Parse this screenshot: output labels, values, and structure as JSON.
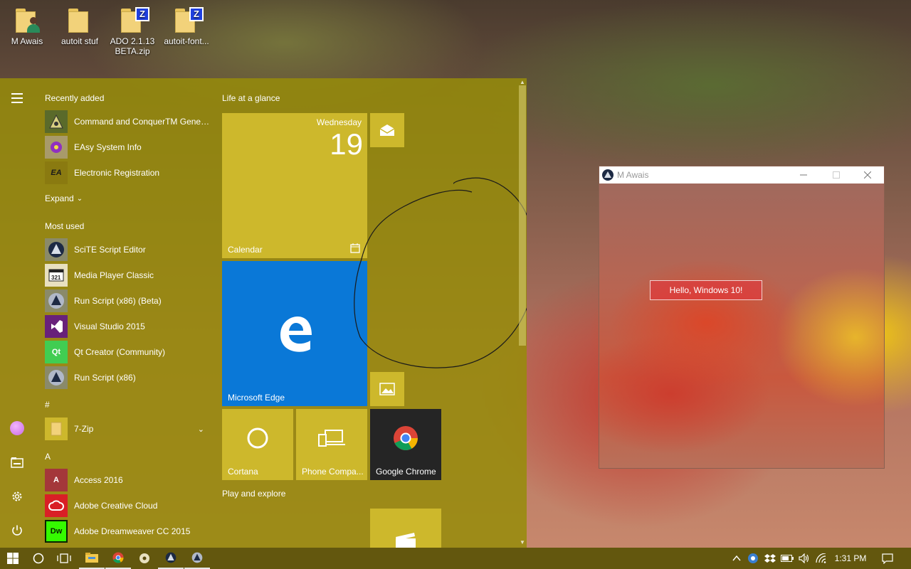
{
  "desktop": {
    "icons": [
      {
        "label": "M Awais"
      },
      {
        "label": "autoit stuf"
      },
      {
        "label": "ADO 2.1.13 BETA.zip"
      },
      {
        "label": "autoit-font..."
      }
    ],
    "zip_badge": "Z"
  },
  "start_menu": {
    "recently_added_header": "Recently added",
    "recently_added": [
      {
        "label": "Command and ConquerTM Gener..."
      },
      {
        "label": "EAsy System Info"
      },
      {
        "label": "Electronic Registration",
        "badge": "EA"
      }
    ],
    "expand_label": "Expand",
    "most_used_header": "Most used",
    "most_used": [
      {
        "label": "SciTE Script Editor"
      },
      {
        "label": "Media Player Classic"
      },
      {
        "label": "Run Script (x86) (Beta)"
      },
      {
        "label": "Visual Studio 2015"
      },
      {
        "label": "Qt Creator (Community)",
        "badge": "Qt"
      },
      {
        "label": "Run Script (x86)"
      }
    ],
    "hash_header": "#",
    "hash_items": [
      {
        "label": "7-Zip"
      }
    ],
    "a_header": "A",
    "a_items": [
      {
        "label": "Access 2016",
        "badge": "A"
      },
      {
        "label": "Adobe Creative Cloud"
      },
      {
        "label": "Adobe Dreamweaver CC 2015",
        "badge": "Dw"
      }
    ]
  },
  "tiles": {
    "group1_title": "Life at a glance",
    "calendar": {
      "day_name": "Wednesday",
      "day_number": "19",
      "label": "Calendar"
    },
    "edge": {
      "label": "Microsoft Edge"
    },
    "cortana": {
      "label": "Cortana"
    },
    "phone": {
      "label": "Phone Compa..."
    },
    "chrome": {
      "label": "Google Chrome"
    },
    "group2_title": "Play and explore",
    "colors": {
      "tile_yellow": "#cdb82c",
      "edge_blue": "#0a78d7",
      "chrome_dark": "#252525"
    }
  },
  "app_window": {
    "title": "M Awais",
    "button_label": "Hello, Windows 10!"
  },
  "taskbar": {
    "clock": "1:31 PM",
    "tray_icons": [
      "show-hidden-icons",
      "network-adapter",
      "dropbox",
      "battery",
      "volume",
      "wifi"
    ],
    "pinned": [
      "start",
      "cortana",
      "task-view",
      "file-explorer",
      "chrome",
      "media-player",
      "autoit",
      "autoit"
    ]
  }
}
